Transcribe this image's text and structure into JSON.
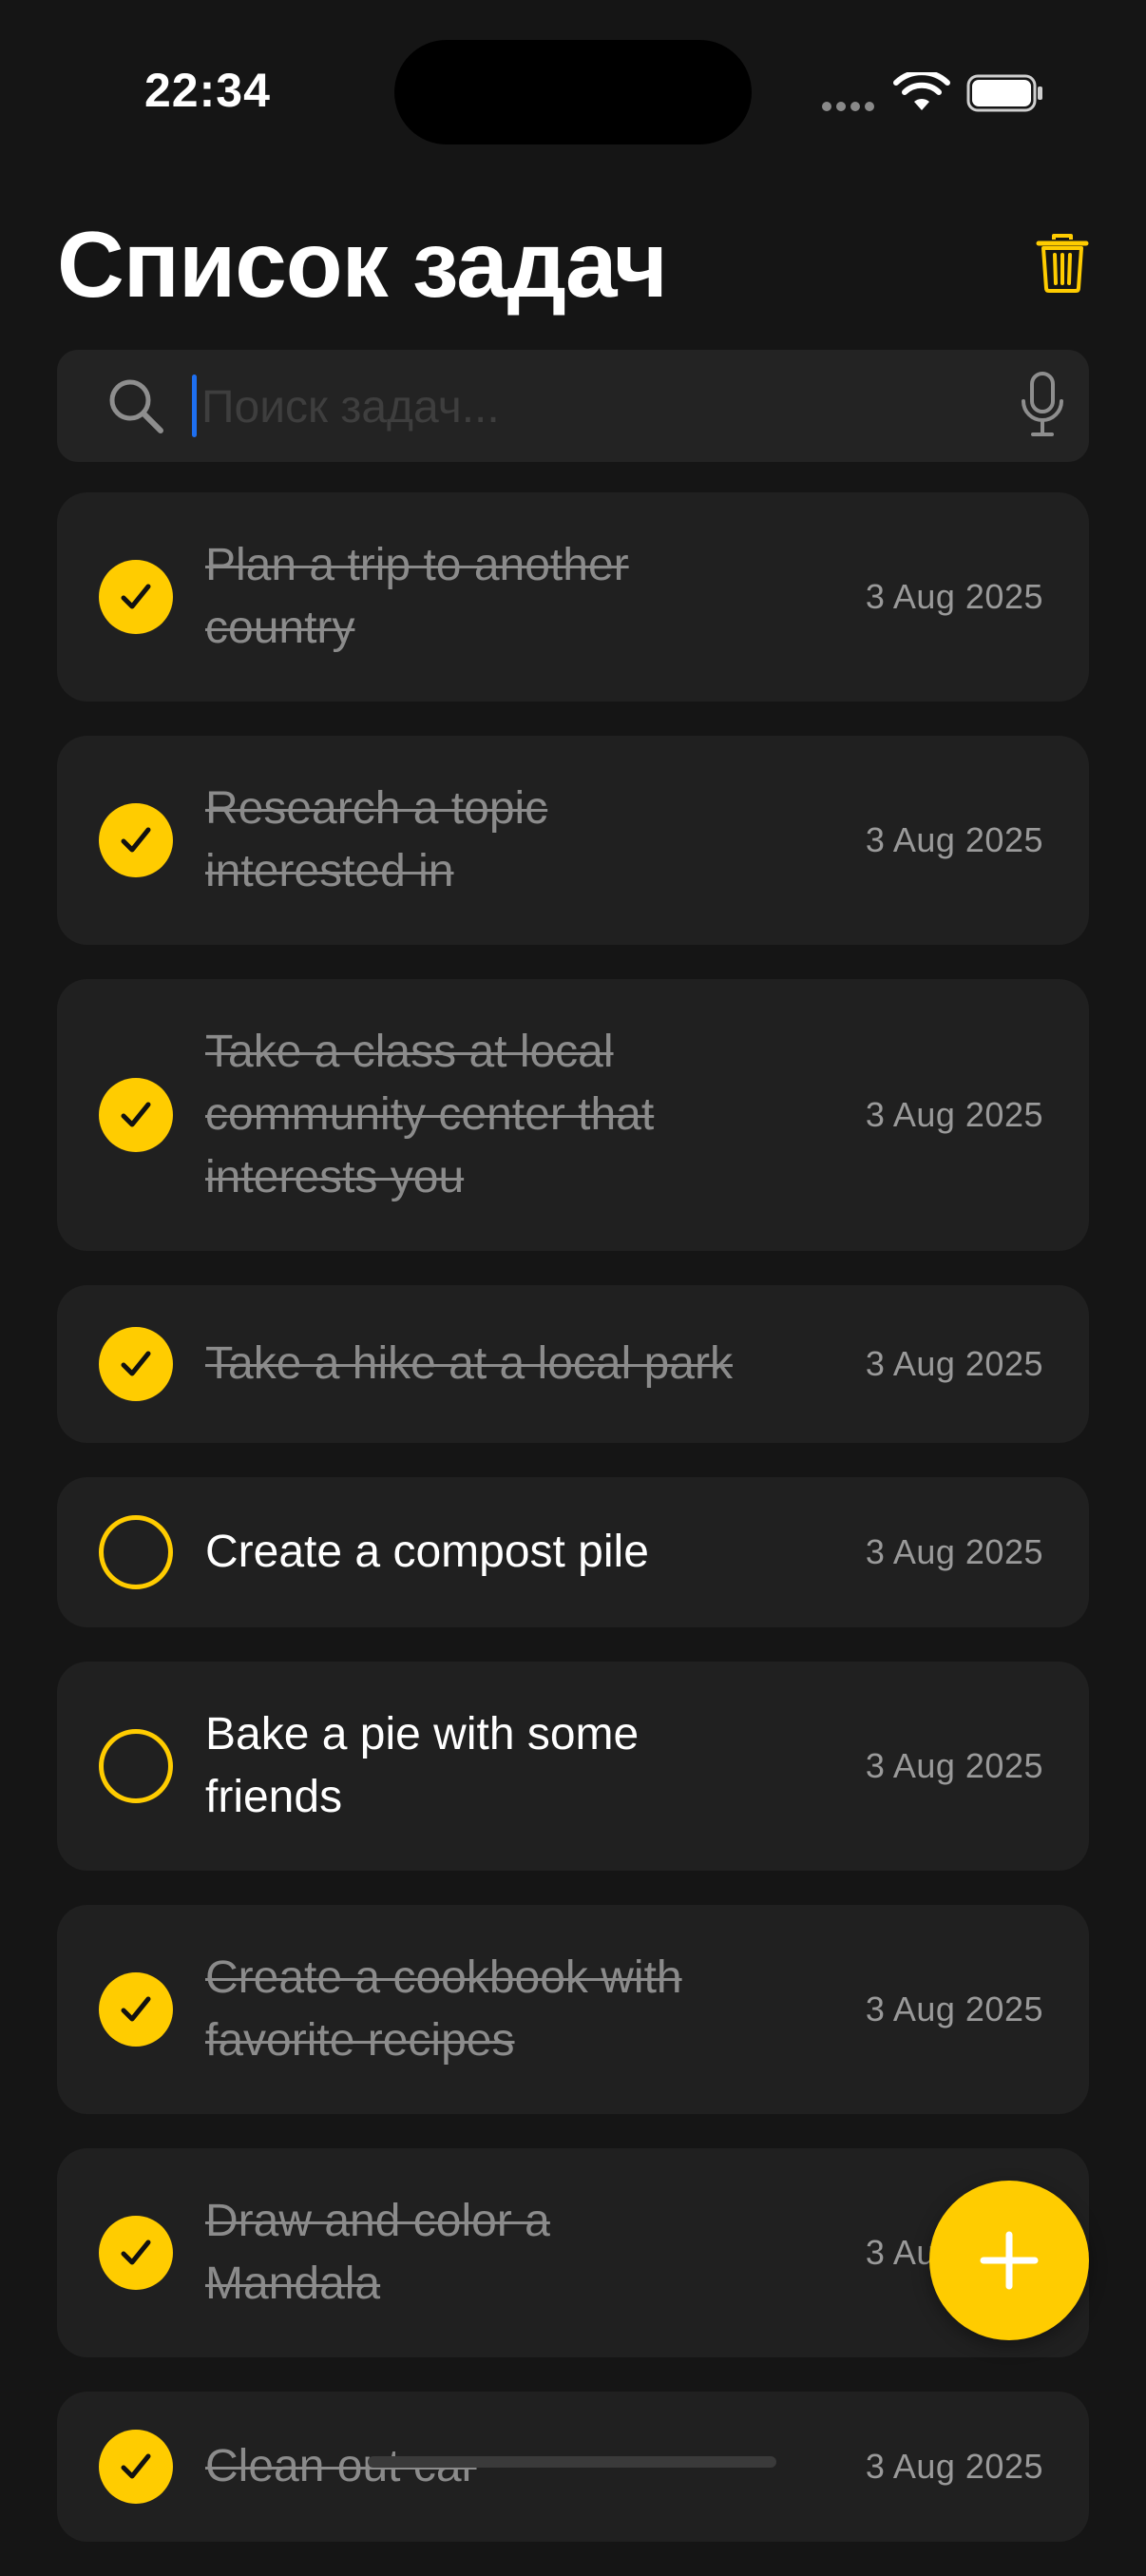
{
  "status_bar": {
    "time": "22:34"
  },
  "header": {
    "title": "Список задач",
    "trash_icon": "trash-icon"
  },
  "search": {
    "placeholder": "Поиск задач...",
    "value": "",
    "search_icon": "search-icon",
    "mic_icon": "microphone-icon"
  },
  "tasks": [
    {
      "title": "Plan a trip to another country",
      "date": "3 Aug 2025",
      "completed": true
    },
    {
      "title": "Research a topic interested in",
      "date": "3 Aug 2025",
      "completed": true
    },
    {
      "title": "Take a class at local community center that interests you",
      "date": "3 Aug 2025",
      "completed": true
    },
    {
      "title": "Take a hike at a local park",
      "date": "3 Aug 2025",
      "completed": true
    },
    {
      "title": "Create a compost pile",
      "date": "3 Aug 2025",
      "completed": false
    },
    {
      "title": "Bake a pie with some friends",
      "date": "3 Aug 2025",
      "completed": false
    },
    {
      "title": "Create a cookbook with favorite recipes",
      "date": "3 Aug 2025",
      "completed": true
    },
    {
      "title": "Draw and color a Mandala",
      "date": "3 Aug 2025",
      "completed": true
    },
    {
      "title": "Clean out car",
      "date": "3 Aug 2025",
      "completed": true
    }
  ],
  "fab": {
    "icon": "plus-icon"
  },
  "colors": {
    "accent": "#ffcc00",
    "background": "#151515",
    "card": "#202020",
    "cursor": "#1e6ff0"
  }
}
